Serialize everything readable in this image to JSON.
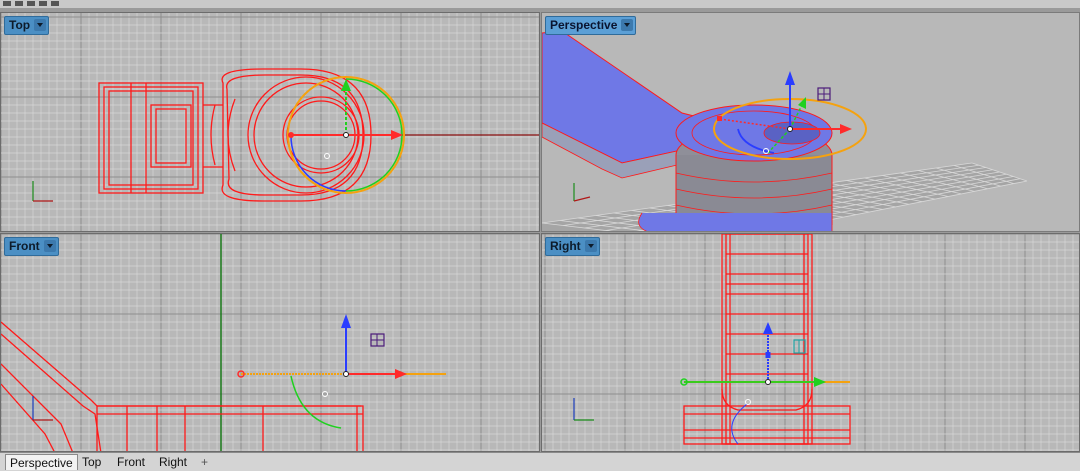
{
  "viewports": {
    "top": {
      "label": "Top"
    },
    "perspective": {
      "label": "Perspective"
    },
    "front": {
      "label": "Front"
    },
    "right": {
      "label": "Right"
    }
  },
  "tabs": [
    {
      "label": "Perspective",
      "active": true
    },
    {
      "label": "Top",
      "active": false
    },
    {
      "label": "Front",
      "active": false
    },
    {
      "label": "Right",
      "active": false
    }
  ],
  "tab_add_symbol": "+",
  "colors": {
    "viewport_bg": "#b8b8b8",
    "grid_minor": "#d6d6d6",
    "grid_major": "#8e8e8e",
    "wire": "#ff1a1a",
    "gumball_x": "#ff2a2a",
    "gumball_y": "#1fd11f",
    "gumball_z": "#2a3dff",
    "gumball_ring": "#f5a20f",
    "title_tab": "#4b8fc4",
    "surface": "#6f78e6"
  },
  "icons": [
    "dropdown-caret-icon",
    "add-tab-icon",
    "gumball-widget",
    "world-axes-icon"
  ]
}
